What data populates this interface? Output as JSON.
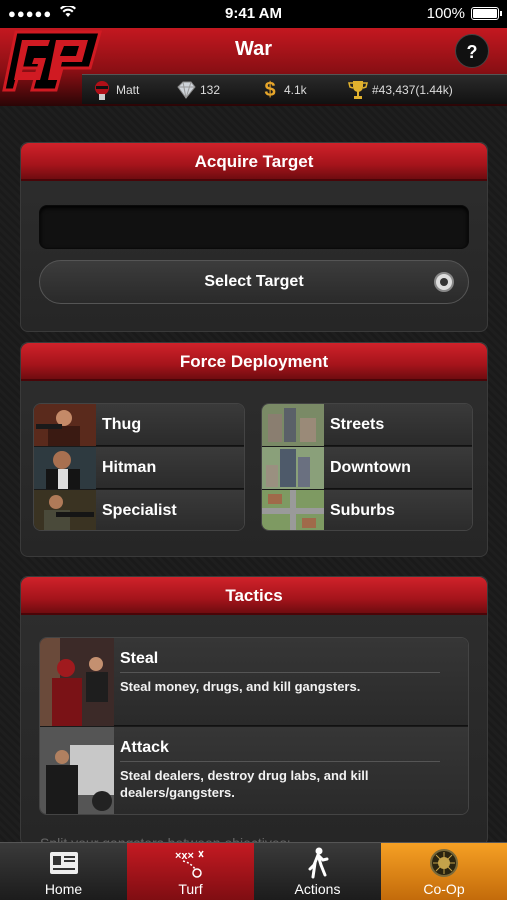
{
  "status_bar": {
    "signal": "●●●●●",
    "time": "9:41 AM",
    "battery": "100%"
  },
  "header": {
    "title": "War",
    "help_label": "?",
    "stats": {
      "username": "Matt",
      "diamonds": "132",
      "cash": "4.1k",
      "rank": "#43,437(1.44k)"
    }
  },
  "acquire": {
    "title": "Acquire Target",
    "target_value": "",
    "select_label": "Select Target"
  },
  "force": {
    "title": "Force Deployment",
    "units": [
      {
        "label": "Thug",
        "icon": "thug-icon"
      },
      {
        "label": "Hitman",
        "icon": "hitman-icon"
      },
      {
        "label": "Specialist",
        "icon": "specialist-icon"
      }
    ],
    "locations": [
      {
        "label": "Streets",
        "icon": "streets-icon"
      },
      {
        "label": "Downtown",
        "icon": "downtown-icon"
      },
      {
        "label": "Suburbs",
        "icon": "suburbs-icon"
      }
    ]
  },
  "tactics": {
    "title": "Tactics",
    "items": [
      {
        "name": "Steal",
        "description": "Steal money, drugs, and kill gangsters."
      },
      {
        "name": "Attack",
        "description": "Steal dealers, destroy drug labs, and kill dealers/gangsters."
      }
    ],
    "split_text": "Split your gangsters between objectives:"
  },
  "tabs": [
    {
      "label": "Home",
      "icon": "home-icon"
    },
    {
      "label": "Turf",
      "icon": "turf-icon"
    },
    {
      "label": "Actions",
      "icon": "actions-icon"
    },
    {
      "label": "Co-Op",
      "icon": "coop-icon"
    }
  ],
  "colors": {
    "accent_red": "#c41820",
    "coop_orange": "#f6a024",
    "background": "#1b1b1b"
  }
}
